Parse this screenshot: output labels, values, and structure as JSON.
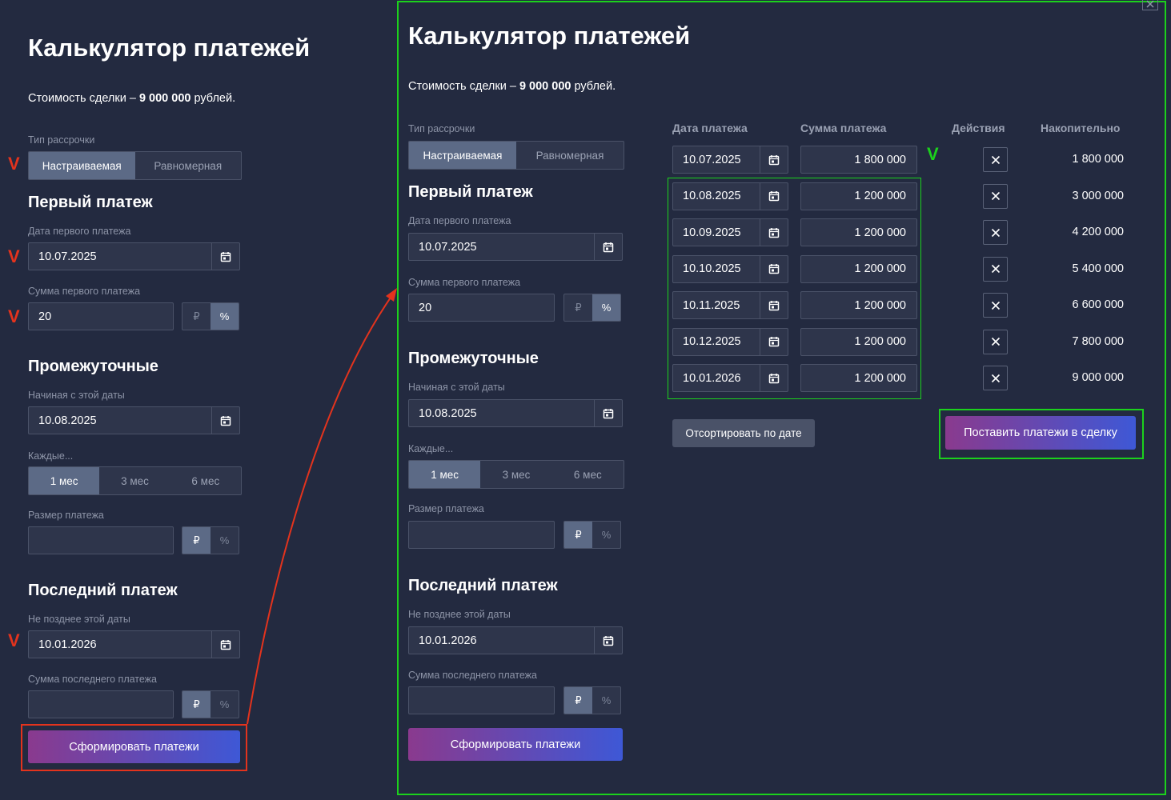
{
  "colors": {
    "background": "#232a40",
    "accent_gradient_start": "#8a3a8e",
    "accent_gradient_end": "#3e58d6",
    "red_annotation": "#e3331d",
    "green_annotation": "#1cd11c"
  },
  "calculator": {
    "title": "Калькулятор платежей",
    "cost_prefix": "Стоимость сделки – ",
    "cost_value": "9 000 000",
    "cost_suffix": " рублей.",
    "installment_type_label": "Тип рассрочки",
    "installment_types": [
      "Настраиваемая",
      "Равномерная"
    ],
    "installment_selected": "Настраиваемая",
    "first_payment": {
      "heading": "Первый платеж",
      "date_label": "Дата первого платежа",
      "date_value": "10.07.2025",
      "amount_label": "Сумма первого платежа",
      "amount_value": "20",
      "unit_rub": "₽",
      "unit_pct": "%",
      "unit_selected": "%"
    },
    "intermediate": {
      "heading": "Промежуточные",
      "start_label": "Начиная с этой даты",
      "start_value": "10.08.2025",
      "every_label": "Каждые...",
      "every_options": [
        "1 мес",
        "3 мес",
        "6 мес"
      ],
      "every_selected": "1 мес",
      "size_label": "Размер платежа",
      "size_value": "",
      "unit_rub": "₽",
      "unit_pct": "%",
      "unit_selected": "₽"
    },
    "last_payment": {
      "heading": "Последний платеж",
      "date_label": "Не позднее этой даты",
      "date_value": "10.01.2026",
      "amount_label": "Сумма последнего платежа",
      "amount_value": "",
      "unit_rub": "₽",
      "unit_pct": "%",
      "unit_selected": "₽"
    },
    "generate_button": "Сформировать платежи"
  },
  "schedule": {
    "headers": [
      "Дата платежа",
      "Сумма платежа",
      "Действия",
      "Накопительно"
    ],
    "rows": [
      {
        "date": "10.07.2025",
        "amount": "1 800 000",
        "cumulative": "1 800 000"
      },
      {
        "date": "10.08.2025",
        "amount": "1 200 000",
        "cumulative": "3 000 000"
      },
      {
        "date": "10.09.2025",
        "amount": "1 200 000",
        "cumulative": "4 200 000"
      },
      {
        "date": "10.10.2025",
        "amount": "1 200 000",
        "cumulative": "5 400 000"
      },
      {
        "date": "10.11.2025",
        "amount": "1 200 000",
        "cumulative": "6 600 000"
      },
      {
        "date": "10.12.2025",
        "amount": "1 200 000",
        "cumulative": "7 800 000"
      },
      {
        "date": "10.01.2026",
        "amount": "1 200 000",
        "cumulative": "9 000 000"
      }
    ],
    "sort_button": "Отсортировать по дате",
    "apply_button": "Поставить платежи в сделку"
  },
  "annotations": {
    "check_mark": "V"
  },
  "icons": {
    "calendar": "calendar-icon",
    "remove": "close-icon",
    "modal_close": "close-icon"
  }
}
